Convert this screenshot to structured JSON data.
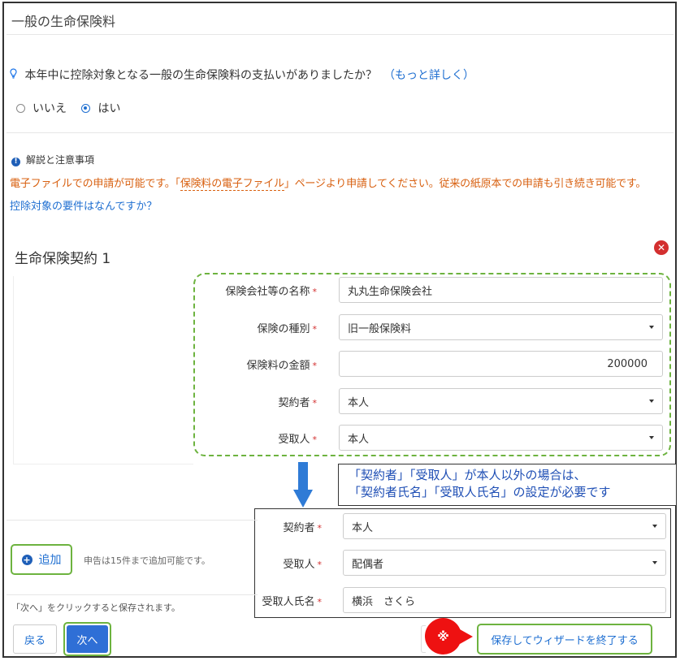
{
  "page": {
    "title": "一般の生命保険料"
  },
  "question": {
    "text": "本年中に控除対象となる一般の生命保険料の支払いがありましたか？",
    "more_link": "（もっと詳しく）",
    "options": [
      "いいえ",
      "はい"
    ],
    "selected": "はい"
  },
  "notes": {
    "title": "解説と注意事項",
    "body_before": "電子ファイルでの申請が可能です。「",
    "body_link": "保険料の電子ファイル",
    "body_after": "」ページより申請してください。従来の紙原本での申請も引き続き可能です。",
    "requirements_link": "控除対象の要件はなんですか？"
  },
  "contract": {
    "title": "生命保険契約 1",
    "remove_icon": "times-circle-icon",
    "fields": {
      "company_label": "保険会社等の名称",
      "company_value": "丸丸生命保険会社",
      "type_label": "保険の種別",
      "type_value": "旧一般保険料",
      "amount_label": "保険料の金額",
      "amount_value": "200000",
      "policyholder_label": "契約者",
      "policyholder_value": "本人",
      "recipient_label": "受取人",
      "recipient_value": "本人"
    }
  },
  "callout": {
    "line1": "「契約者」「受取人」が本人以外の場合は、",
    "line2": "「契約者氏名」「受取人氏名」の設定が必要です"
  },
  "example": {
    "policyholder_label": "契約者",
    "policyholder_value": "本人",
    "recipient_label": "受取人",
    "recipient_value": "配偶者",
    "recipient_name_label": "受取人氏名",
    "recipient_name_value": "横浜　さくら"
  },
  "add": {
    "label": "追加",
    "note": "申告は15件まで追加可能です。"
  },
  "footer": {
    "save_note": "「次へ」をクリックすると保存されます。",
    "back_label": "戻る",
    "next_label": "次へ",
    "marker": "※",
    "finish_label": "保存してウィザードを終了する"
  },
  "colors": {
    "accent": "#2f6fd6",
    "highlight": "#6db33f",
    "warning": "#d86010",
    "marker": "#ee1111"
  }
}
